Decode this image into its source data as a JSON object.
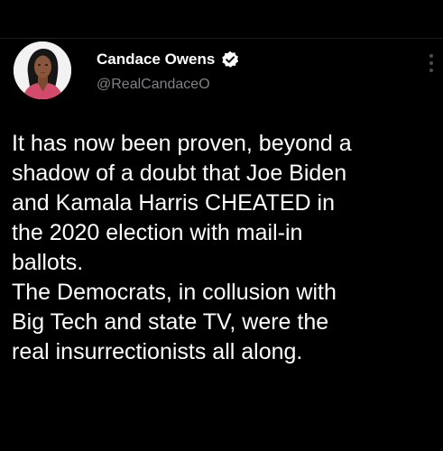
{
  "tweet": {
    "author": {
      "display_name": "Candace Owens",
      "handle": "@RealCandaceO",
      "verified": true,
      "verified_color": "#ffffff"
    },
    "body_lines": [
      "It has now been proven, beyond a",
      "shadow of a doubt that Joe Biden",
      "and Kamala Harris CHEATED in",
      "the 2020 election with mail-in",
      "ballots.",
      "The Democrats, in collusion with",
      "Big Tech and state TV, were the",
      "real insurrectionists all along."
    ],
    "icons": {
      "avatar": "profile-photo",
      "verified": "verified-badge-icon",
      "more": "more-options-icon"
    }
  },
  "colors": {
    "background": "#000000",
    "text": "#ffffff",
    "handle": "#7d8287"
  }
}
